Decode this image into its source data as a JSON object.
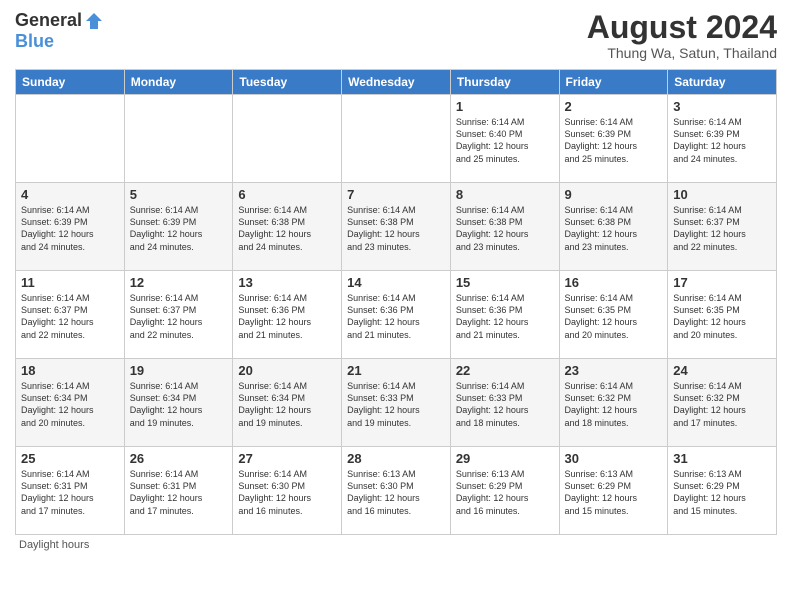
{
  "header": {
    "logo_general": "General",
    "logo_blue": "Blue",
    "month_year": "August 2024",
    "location": "Thung Wa, Satun, Thailand"
  },
  "weekdays": [
    "Sunday",
    "Monday",
    "Tuesday",
    "Wednesday",
    "Thursday",
    "Friday",
    "Saturday"
  ],
  "footer": {
    "daylight_label": "Daylight hours"
  },
  "weeks": [
    [
      {
        "day": "",
        "info": ""
      },
      {
        "day": "",
        "info": ""
      },
      {
        "day": "",
        "info": ""
      },
      {
        "day": "",
        "info": ""
      },
      {
        "day": "1",
        "info": "Sunrise: 6:14 AM\nSunset: 6:40 PM\nDaylight: 12 hours\nand 25 minutes."
      },
      {
        "day": "2",
        "info": "Sunrise: 6:14 AM\nSunset: 6:39 PM\nDaylight: 12 hours\nand 25 minutes."
      },
      {
        "day": "3",
        "info": "Sunrise: 6:14 AM\nSunset: 6:39 PM\nDaylight: 12 hours\nand 24 minutes."
      }
    ],
    [
      {
        "day": "4",
        "info": "Sunrise: 6:14 AM\nSunset: 6:39 PM\nDaylight: 12 hours\nand 24 minutes."
      },
      {
        "day": "5",
        "info": "Sunrise: 6:14 AM\nSunset: 6:39 PM\nDaylight: 12 hours\nand 24 minutes."
      },
      {
        "day": "6",
        "info": "Sunrise: 6:14 AM\nSunset: 6:38 PM\nDaylight: 12 hours\nand 24 minutes."
      },
      {
        "day": "7",
        "info": "Sunrise: 6:14 AM\nSunset: 6:38 PM\nDaylight: 12 hours\nand 23 minutes."
      },
      {
        "day": "8",
        "info": "Sunrise: 6:14 AM\nSunset: 6:38 PM\nDaylight: 12 hours\nand 23 minutes."
      },
      {
        "day": "9",
        "info": "Sunrise: 6:14 AM\nSunset: 6:38 PM\nDaylight: 12 hours\nand 23 minutes."
      },
      {
        "day": "10",
        "info": "Sunrise: 6:14 AM\nSunset: 6:37 PM\nDaylight: 12 hours\nand 22 minutes."
      }
    ],
    [
      {
        "day": "11",
        "info": "Sunrise: 6:14 AM\nSunset: 6:37 PM\nDaylight: 12 hours\nand 22 minutes."
      },
      {
        "day": "12",
        "info": "Sunrise: 6:14 AM\nSunset: 6:37 PM\nDaylight: 12 hours\nand 22 minutes."
      },
      {
        "day": "13",
        "info": "Sunrise: 6:14 AM\nSunset: 6:36 PM\nDaylight: 12 hours\nand 21 minutes."
      },
      {
        "day": "14",
        "info": "Sunrise: 6:14 AM\nSunset: 6:36 PM\nDaylight: 12 hours\nand 21 minutes."
      },
      {
        "day": "15",
        "info": "Sunrise: 6:14 AM\nSunset: 6:36 PM\nDaylight: 12 hours\nand 21 minutes."
      },
      {
        "day": "16",
        "info": "Sunrise: 6:14 AM\nSunset: 6:35 PM\nDaylight: 12 hours\nand 20 minutes."
      },
      {
        "day": "17",
        "info": "Sunrise: 6:14 AM\nSunset: 6:35 PM\nDaylight: 12 hours\nand 20 minutes."
      }
    ],
    [
      {
        "day": "18",
        "info": "Sunrise: 6:14 AM\nSunset: 6:34 PM\nDaylight: 12 hours\nand 20 minutes."
      },
      {
        "day": "19",
        "info": "Sunrise: 6:14 AM\nSunset: 6:34 PM\nDaylight: 12 hours\nand 19 minutes."
      },
      {
        "day": "20",
        "info": "Sunrise: 6:14 AM\nSunset: 6:34 PM\nDaylight: 12 hours\nand 19 minutes."
      },
      {
        "day": "21",
        "info": "Sunrise: 6:14 AM\nSunset: 6:33 PM\nDaylight: 12 hours\nand 19 minutes."
      },
      {
        "day": "22",
        "info": "Sunrise: 6:14 AM\nSunset: 6:33 PM\nDaylight: 12 hours\nand 18 minutes."
      },
      {
        "day": "23",
        "info": "Sunrise: 6:14 AM\nSunset: 6:32 PM\nDaylight: 12 hours\nand 18 minutes."
      },
      {
        "day": "24",
        "info": "Sunrise: 6:14 AM\nSunset: 6:32 PM\nDaylight: 12 hours\nand 17 minutes."
      }
    ],
    [
      {
        "day": "25",
        "info": "Sunrise: 6:14 AM\nSunset: 6:31 PM\nDaylight: 12 hours\nand 17 minutes."
      },
      {
        "day": "26",
        "info": "Sunrise: 6:14 AM\nSunset: 6:31 PM\nDaylight: 12 hours\nand 17 minutes."
      },
      {
        "day": "27",
        "info": "Sunrise: 6:14 AM\nSunset: 6:30 PM\nDaylight: 12 hours\nand 16 minutes."
      },
      {
        "day": "28",
        "info": "Sunrise: 6:13 AM\nSunset: 6:30 PM\nDaylight: 12 hours\nand 16 minutes."
      },
      {
        "day": "29",
        "info": "Sunrise: 6:13 AM\nSunset: 6:29 PM\nDaylight: 12 hours\nand 16 minutes."
      },
      {
        "day": "30",
        "info": "Sunrise: 6:13 AM\nSunset: 6:29 PM\nDaylight: 12 hours\nand 15 minutes."
      },
      {
        "day": "31",
        "info": "Sunrise: 6:13 AM\nSunset: 6:29 PM\nDaylight: 12 hours\nand 15 minutes."
      }
    ]
  ]
}
